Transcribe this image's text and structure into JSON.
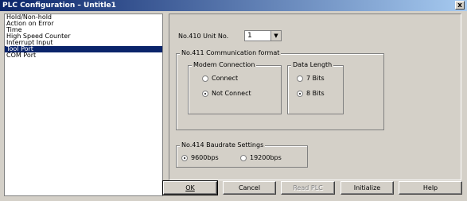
{
  "window": {
    "title": "PLC Configuration – Untitle1",
    "close_glyph": "x"
  },
  "sidebar": {
    "items": [
      {
        "label": "Hold/Non-hold",
        "selected": false
      },
      {
        "label": "Action on Error",
        "selected": false
      },
      {
        "label": "Time",
        "selected": false
      },
      {
        "label": "High Speed Counter",
        "selected": false
      },
      {
        "label": "Interrupt Input",
        "selected": false
      },
      {
        "label": "Tool Port",
        "selected": true
      },
      {
        "label": "COM Port",
        "selected": false
      }
    ]
  },
  "unit": {
    "label": "No.410 Unit No.",
    "value": "1",
    "arrow": "▼"
  },
  "comm_format": {
    "legend": "No.411 Communication format",
    "modem": {
      "legend": "Modem Connection",
      "options": [
        {
          "label": "Connect",
          "checked": false
        },
        {
          "label": "Not Connect",
          "checked": true
        }
      ]
    },
    "data_length": {
      "legend": "Data Length",
      "options": [
        {
          "label": "7 Bits",
          "checked": false
        },
        {
          "label": "8 Bits",
          "checked": true
        }
      ]
    }
  },
  "baudrate": {
    "legend": "No.414 Baudrate Settings",
    "options": [
      {
        "label": "9600bps",
        "checked": true
      },
      {
        "label": "19200bps",
        "checked": false
      }
    ]
  },
  "buttons": {
    "ok": "OK",
    "cancel": "Cancel",
    "read_plc": "Read PLC",
    "initialize": "Initialize",
    "help": "Help"
  }
}
